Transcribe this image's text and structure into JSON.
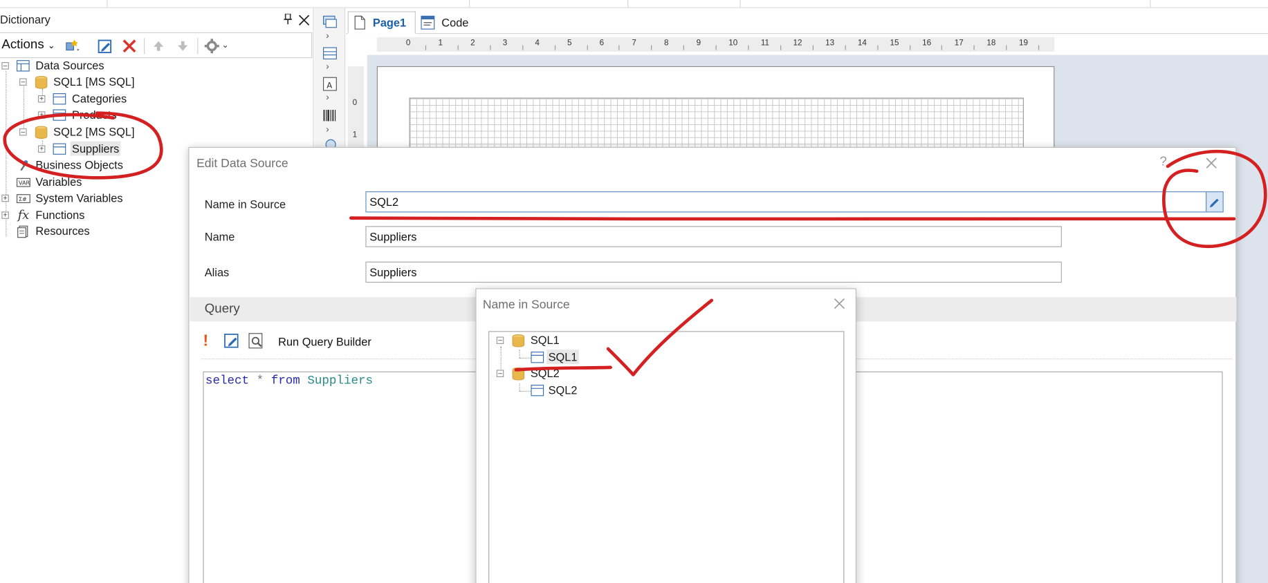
{
  "dictionary": {
    "title": "Dictionary",
    "toolbar": {
      "actions_label": "Actions"
    },
    "tree": {
      "data_sources": "Data Sources",
      "sql1": "SQL1 [MS SQL]",
      "categories": "Categories",
      "products": "Products",
      "sql2": "SQL2 [MS SQL]",
      "suppliers": "Suppliers",
      "business_objects": "Business Objects",
      "variables": "Variables",
      "system_variables": "System Variables",
      "functions": "Functions",
      "resources": "Resources"
    }
  },
  "designer": {
    "tabs": [
      "Page1",
      "Code"
    ],
    "ruler": [
      "0",
      "1",
      "2",
      "3",
      "4",
      "5",
      "6",
      "7",
      "8",
      "9",
      "10",
      "11",
      "12",
      "13",
      "14",
      "15",
      "16",
      "17",
      "18",
      "19"
    ],
    "vruler": [
      "0",
      "1"
    ]
  },
  "edit_dialog": {
    "title": "Edit Data Source",
    "help": "?",
    "name_in_source_label": "Name in Source",
    "name_in_source_value": "SQL2",
    "name_label": "Name",
    "name_value": "Suppliers",
    "alias_label": "Alias",
    "alias_value": "Suppliers",
    "query_title": "Query",
    "run_query_builder": "Run Query Builder",
    "query": {
      "kw1": "select",
      "op": "*",
      "kw2": "from",
      "table": "Suppliers"
    }
  },
  "name_popup": {
    "title": "Name in Source",
    "tree": {
      "sql1": "SQL1",
      "sql1_table": "SQL1",
      "sql2": "SQL2",
      "sql2_table": "SQL2"
    }
  },
  "colors": {
    "accent": "#1b5fa8",
    "annotation": "#d42020",
    "db_icon": "#e8b84a"
  }
}
